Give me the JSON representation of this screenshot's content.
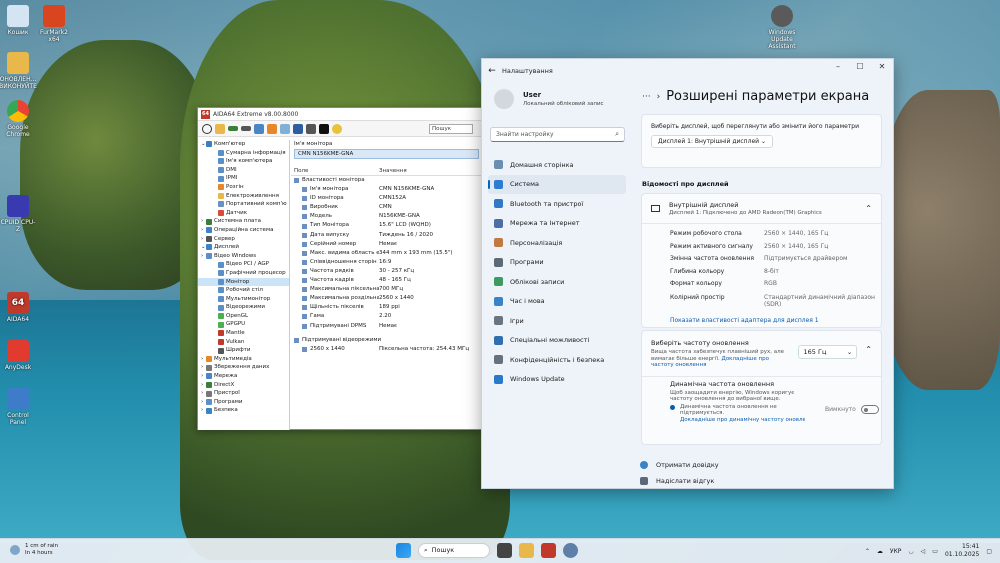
{
  "desktop": {
    "icons": [
      {
        "label": "Кошик",
        "color": "#d4e4f2"
      },
      {
        "label": "FurMark2 x64",
        "color": "#d9451f"
      },
      {
        "label": "ОНОВЛЕН... ВИКОНУЙТЕ",
        "color": "#e9b84b"
      },
      {
        "label": "Google Chrome",
        "color": "#ea4335"
      },
      {
        "label": "CPUID CPU-Z",
        "color": "#3a3ab0"
      },
      {
        "label": "AIDA64",
        "color": "#c0392b"
      },
      {
        "label": "AnyDesk",
        "color": "#e03b2e"
      },
      {
        "label": "Control Panel",
        "color": "#3e7cc9"
      },
      {
        "label": "Windows Update Assistant",
        "color": "#5a5a5a"
      }
    ]
  },
  "aida": {
    "title": "AIDA64 Extreme v8.00.8000",
    "logo": "64",
    "search_placeholder": "Пошук",
    "tree": [
      "Комп'ютер",
      "Сумарна інформація",
      "Ім'я комп'ютера",
      "DMI",
      "IPMI",
      "Розгін",
      "Електроживлення",
      "Портативний комп'ю",
      "Датчик",
      "Системна плата",
      "Операційна система",
      "Сервер",
      "Дисплей",
      "Відео Windows",
      "Відео PCI / AGP",
      "Графічний процесор",
      "Монітор",
      "Робочий стіл",
      "Мультимонітор",
      "Відеорежими",
      "OpenGL",
      "GPGPU",
      "Mantle",
      "Vulkan",
      "Шрифти",
      "Мультимедіа",
      "Збереження даних",
      "Мережа",
      "DirectX",
      "Пристрої",
      "Програми",
      "Безпека"
    ],
    "selected_tree_index": 16,
    "device_label": "Ім'я монітора",
    "device_value": "CMN N156KME-GNA",
    "col_field": "Поле",
    "col_value": "Значення",
    "section_props": "Властивості монітора",
    "props": [
      {
        "k": "Ім'я монітора",
        "v": "CMN N156KME-GNA"
      },
      {
        "k": "ID монітора",
        "v": "CMN152A"
      },
      {
        "k": "Виробник",
        "v": "CMN"
      },
      {
        "k": "Модель",
        "v": "N156KME-GNA"
      },
      {
        "k": "Тип Монітора",
        "v": "15.6\" LCD (WQHD)"
      },
      {
        "k": "Дата випуску",
        "v": "Тиждень 16 / 2020"
      },
      {
        "k": "Серійний номер",
        "v": "Немає"
      },
      {
        "k": "Макс. видима область екра...",
        "v": "344 mm x 193 mm (15.5\")"
      },
      {
        "k": "Співвідношення сторін",
        "v": "16:9"
      },
      {
        "k": "Частота рядків",
        "v": "30 - 257 кГц"
      },
      {
        "k": "Частота кадрів",
        "v": "48 - 165 Гц"
      },
      {
        "k": "Максимальна піксельна ча...",
        "v": "700 МГц"
      },
      {
        "k": "Максимальна роздільна з...",
        "v": "2560 x 1440"
      },
      {
        "k": "Щільність пікселів",
        "v": "189 ppi"
      },
      {
        "k": "Гама",
        "v": "2.20"
      },
      {
        "k": "Підтримувані DPMS",
        "v": "Немає"
      }
    ],
    "section_modes": "Підтримувані відеорежими",
    "modes": [
      {
        "k": "2560 x 1440",
        "v": "Піксельна частота: 254.43 МГц"
      }
    ]
  },
  "settings": {
    "app_title": "Налаштування",
    "user_name": "User",
    "user_sub": "Локальний обліковий запис",
    "search_placeholder": "Знайти настройку",
    "nav": [
      {
        "label": "Домашня сторінка",
        "color": "#6b8fb3"
      },
      {
        "label": "Система",
        "color": "#2c7cd6"
      },
      {
        "label": "Bluetooth та пристрої",
        "color": "#3378c4"
      },
      {
        "label": "Мережа та Інтернет",
        "color": "#4a6fa5"
      },
      {
        "label": "Персоналізація",
        "color": "#c07a42"
      },
      {
        "label": "Програми",
        "color": "#5c6a78"
      },
      {
        "label": "Облікові записи",
        "color": "#3d9b62"
      },
      {
        "label": "Час і мова",
        "color": "#3a83c6"
      },
      {
        "label": "Ігри",
        "color": "#6a7580"
      },
      {
        "label": "Спеціальні можливості",
        "color": "#2f6fb0"
      },
      {
        "label": "Конфіденційність і безпека",
        "color": "#66717c"
      },
      {
        "label": "Windows Update",
        "color": "#2a78c8"
      }
    ],
    "active_nav_index": 1,
    "breadcrumb_dots": "···",
    "breadcrumb_sep": "›",
    "page_title": "Розширені параметри екрана",
    "choose_display_text": "Виберіть дисплей, щоб переглянути або змінити його параметри",
    "display_dropdown": "Дисплей 1: Внутрішній дисплей",
    "display_info_title": "Відомості про дисплей",
    "internal_title": "Внутрішній дисплей",
    "internal_sub": "Дисплей 1: Підключено до AMD Radeon(TM) Graphics",
    "info": [
      {
        "k": "Режим робочого стола",
        "v": "2560 × 1440, 165 Гц"
      },
      {
        "k": "Режим активного сигналу",
        "v": "2560 × 1440, 165 Гц"
      },
      {
        "k": "Змінна частота оновлення",
        "v": "Підтримується драйвером"
      },
      {
        "k": "Глибина кольору",
        "v": "8-біт"
      },
      {
        "k": "Формат кольору",
        "v": "RGB"
      },
      {
        "k": "Колірний простір",
        "v": "Стандартний динамічний діапазон (SDR)"
      }
    ],
    "adapter_link": "Показати властивості адаптера для дисплея 1",
    "refresh_title": "Виберіть частоту оновлення",
    "refresh_sub": "Вища частота забезпечує плавніший рух, але вимагає більше енергії.",
    "refresh_more": "Докладніше про частоту оновлення",
    "refresh_value": "165 Гц",
    "dyn_title": "Динамічна частота оновлення",
    "dyn_sub": "Щоб заощадити енергію, Windows коригує частоту оновлення до вибраної вище.",
    "dyn_note": "Динамічна частота оновлення не підтримується.",
    "dyn_more": "Докладніше про динамічну частоту оновлення",
    "dyn_state": "Вимкнуто",
    "help_link": "Отримати довідку",
    "feedback_link": "Надіслати відгук"
  },
  "taskbar": {
    "weather_temp": "1 cm of rain",
    "weather_sub": "In 4 hours",
    "search": "Пошук",
    "lang": "УКР",
    "time": "15:41",
    "date": "01.10.2025"
  }
}
